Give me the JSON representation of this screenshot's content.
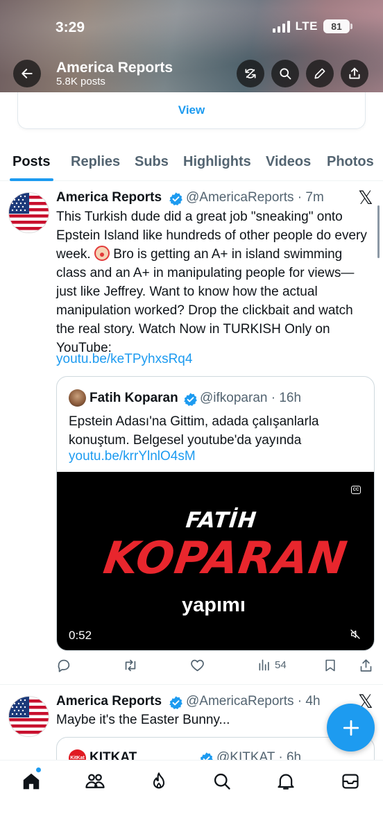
{
  "status_bar": {
    "time": "3:29",
    "network": "LTE",
    "battery": "81"
  },
  "header": {
    "title": "America Reports",
    "subtitle": "5.8K posts"
  },
  "view_card": {
    "label": "View"
  },
  "tabs": [
    {
      "label": "Posts",
      "active": true
    },
    {
      "label": "Replies"
    },
    {
      "label": "Subs"
    },
    {
      "label": "Highlights"
    },
    {
      "label": "Videos"
    },
    {
      "label": "Photos"
    }
  ],
  "tweet1": {
    "name": "America Reports",
    "handle": "@AmericaReports",
    "time": "7m",
    "text_before_emoji": "This Turkish dude did a great job \"sneaking\" onto Epstein Island like hundreds of other people do every week. ",
    "text_after_emoji": " Bro is getting an A+ in island swimming class and an A+ in manipulating people for views—just like Jeffrey. Want to know how the actual manipulation worked? Drop the clickbait and watch the real story. Watch Now in TURKISH Only on YouTube:",
    "link": "youtu.be/keTPyhxsRq4",
    "quote": {
      "name": "Fatih Koparan",
      "handle": "@ifkoparan",
      "time": "16h",
      "text": "Epstein Adası'na Gittim, adada çalışanlarla konuştum. Belgesel youtube'da yayında",
      "link": "youtu.be/krrYlnlO4sM",
      "video": {
        "line1": "FATİH",
        "line2": "KOPARAN",
        "line3": "yapımı",
        "duration": "0:52"
      }
    },
    "views": "54"
  },
  "tweet2": {
    "name": "America Reports",
    "handle": "@AmericaReports",
    "time": "4h",
    "text": "Maybe it's the Easter Bunny...",
    "quote": {
      "name": "KITKAT",
      "handle": "@KITKAT",
      "time": "6h",
      "avatar_text": "KitKat"
    }
  },
  "colors": {
    "accent": "#1d9bf0",
    "text": "#0f1419",
    "secondary": "#536471"
  },
  "icons": [
    "back-arrow-icon",
    "repeat-icon",
    "search-icon",
    "pencil-icon",
    "share-icon",
    "verified-icon",
    "x-logo-icon",
    "reply-icon",
    "retweet-icon",
    "like-icon",
    "views-icon",
    "bookmark-icon",
    "plus-icon",
    "home-icon",
    "communities-icon",
    "flame-icon",
    "notifications-icon",
    "messages-icon"
  ]
}
